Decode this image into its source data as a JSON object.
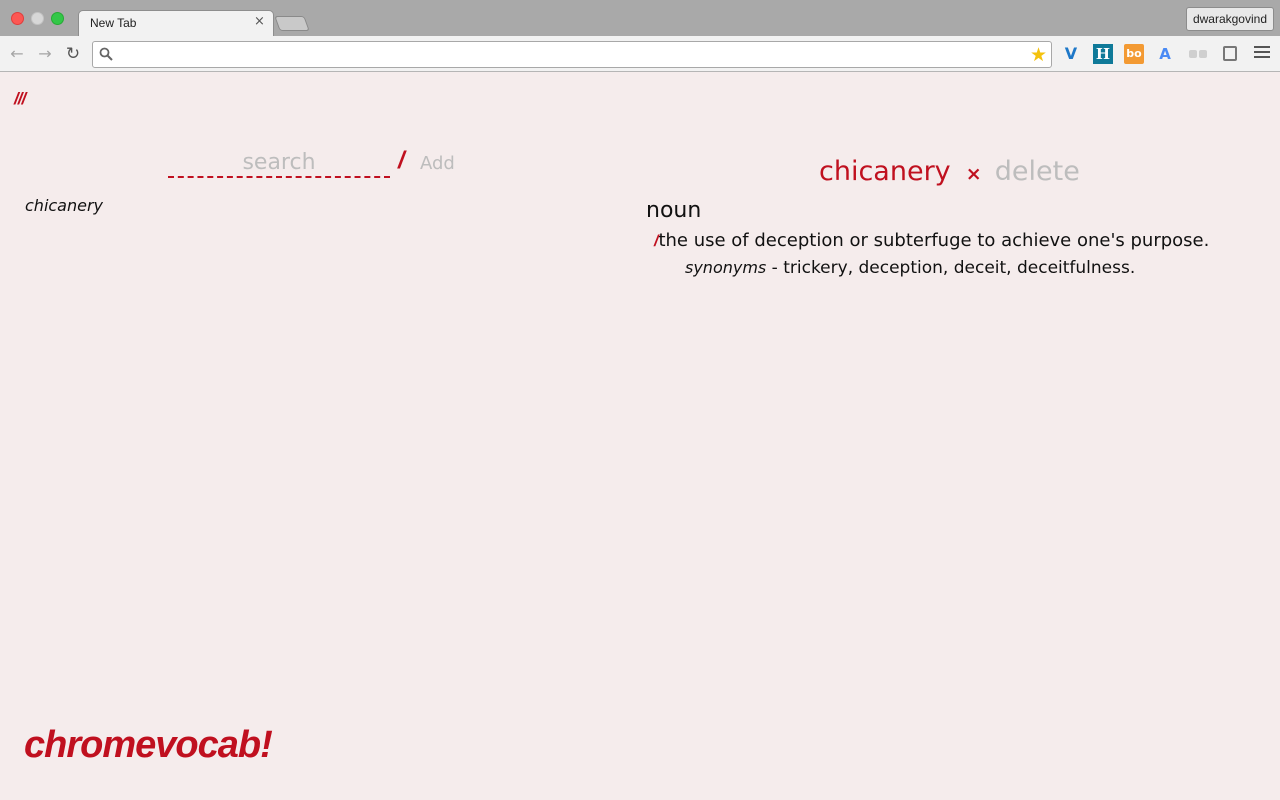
{
  "browser": {
    "tab_title": "New Tab",
    "tab_close": "×",
    "profile_name": "dwarakgovind",
    "omnibox_value": "",
    "extensions": [
      {
        "name": "v-extension-icon",
        "glyph": "V"
      },
      {
        "name": "h-extension-icon",
        "glyph": "H"
      },
      {
        "name": "bo-extension-icon",
        "glyph": "bo"
      },
      {
        "name": "translate-extension-icon",
        "glyph": "A"
      }
    ]
  },
  "app": {
    "logo_mark": "///",
    "search_placeholder": "search",
    "search_slash": "/",
    "add_label": "Add",
    "words": [
      "chicanery"
    ],
    "entry": {
      "word": "chicanery",
      "remove_glyph": "×",
      "delete_label": "delete",
      "part_of_speech": "noun",
      "definition_slash": "/",
      "definition": "the use of deception or subterfuge to achieve one's purpose.",
      "synonyms_label": "synonyms",
      "synonyms_sep": " - ",
      "synonyms": "trickery, deception, deceit, deceitfulness."
    },
    "brand": "chromevocab!"
  },
  "colors": {
    "accent": "#c0101f",
    "background": "#f5ecec",
    "muted": "#bdbdbd"
  }
}
